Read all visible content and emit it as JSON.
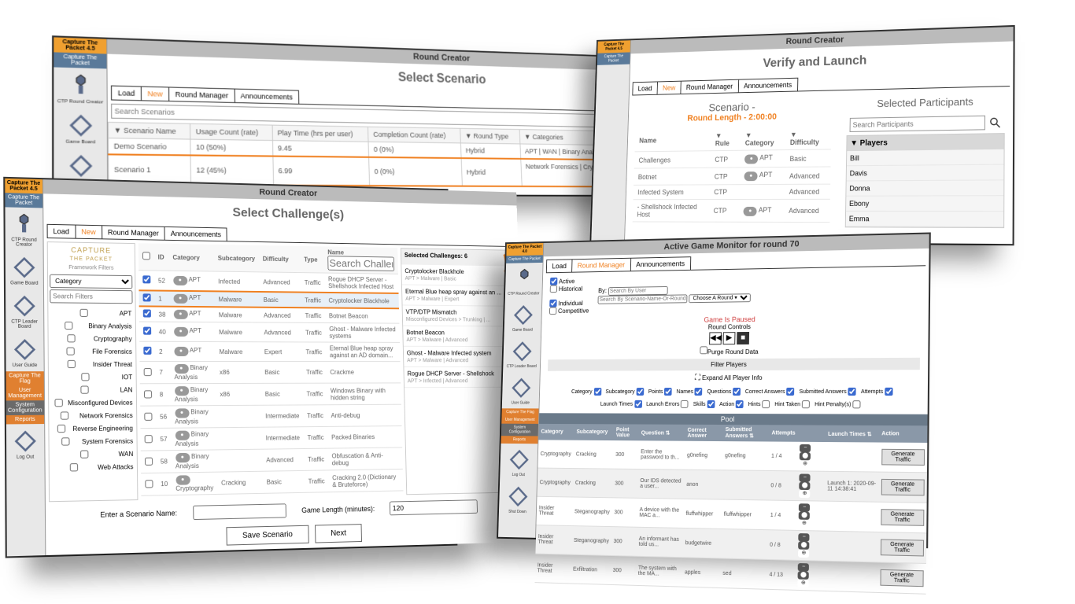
{
  "app": {
    "title45": "Capture The Packet 4.5",
    "title40": "Capture The Packet 4.0",
    "name": "Capture The Packet"
  },
  "sidebar": {
    "items": [
      {
        "label": "CTP Round Creator"
      },
      {
        "label": "Game Board"
      },
      {
        "label": "CTP Leader Board"
      },
      {
        "label": "User Guide"
      }
    ],
    "admin": [
      {
        "label": "Capture The Flag"
      },
      {
        "label": "User Management"
      },
      {
        "label": "System Configuration"
      },
      {
        "label": "Reports"
      }
    ],
    "bottom": [
      {
        "label": "Log Out"
      },
      {
        "label": "Shut Down"
      }
    ]
  },
  "round_creator": "Round Creator",
  "tabs": {
    "load": "Load",
    "new": "New",
    "manager": "Round Manager",
    "ann": "Announcements"
  },
  "p1": {
    "heading": "Select Scenario",
    "search_ph": "Search Scenarios",
    "cols": {
      "name": "▼ Scenario Name",
      "usage": "Usage Count (rate)",
      "play": "Play Time (hrs per user)",
      "comp": "Completion Count (rate)",
      "type": "▼ Round Type",
      "cat": "▼ Categories"
    },
    "rows": [
      {
        "name": "Demo Scenario",
        "usage": "10 (50%)",
        "play": "9.45",
        "comp": "0 (0%)",
        "type": "Hybrid",
        "cat": "APT | WAN | Binary Analysis | Insider Threat | System Forensics | ..."
      },
      {
        "name": "Scenario 1",
        "usage": "12 (45%)",
        "play": "6.99",
        "comp": "0 (0%)",
        "type": "Hybrid",
        "cat": "Network Forensics | Cryptography |"
      }
    ]
  },
  "p2": {
    "heading": "Select Challenge(s)",
    "filters": {
      "logo1": "CAPTURE",
      "logo2": "THE PACKET",
      "sub": "Framework Filters",
      "cat_ph": "Category",
      "search_ph": "Search Filters",
      "list": [
        "APT",
        "Binary Analysis",
        "Cryptography",
        "File Forensics",
        "Insider Threat",
        "IOT",
        "LAN",
        "Misconfigured Devices",
        "Network Forensics",
        "Reverse Engineering",
        "System Forensics",
        "WAN",
        "Web Attacks"
      ]
    },
    "ch_cols": {
      "sel": "",
      "id": "ID",
      "cat": "Category",
      "sub": "Subcategory",
      "diff": "Difficulty",
      "type": "Type",
      "name": "Name"
    },
    "ch_search": "Search Challenge Sets",
    "ch_rows": [
      {
        "id": "52",
        "chk": true,
        "cat": "APT",
        "sub": "Infected",
        "diff": "Advanced",
        "type": "Traffic",
        "name": "Rogue DHCP Server - Shellshock Infected Host"
      },
      {
        "id": "1",
        "chk": true,
        "sel": true,
        "cat": "APT",
        "sub": "Malware",
        "diff": "Basic",
        "type": "Traffic",
        "name": "Cryptolocker Blackhole"
      },
      {
        "id": "38",
        "chk": true,
        "cat": "APT",
        "sub": "Malware",
        "diff": "Advanced",
        "type": "Traffic",
        "name": "Botnet Beacon"
      },
      {
        "id": "40",
        "chk": true,
        "cat": "APT",
        "sub": "Malware",
        "diff": "Advanced",
        "type": "Traffic",
        "name": "Ghost - Malware Infected systems"
      },
      {
        "id": "2",
        "chk": true,
        "cat": "APT",
        "sub": "Malware",
        "diff": "Expert",
        "type": "Traffic",
        "name": "Eternal Blue heap spray against an AD domain..."
      },
      {
        "id": "7",
        "chk": false,
        "cat": "Binary Analysis",
        "sub": "x86",
        "diff": "Basic",
        "type": "Traffic",
        "name": "Crackme"
      },
      {
        "id": "8",
        "chk": false,
        "cat": "Binary Analysis",
        "sub": "x86",
        "diff": "Basic",
        "type": "Traffic",
        "name": "Windows Binary with hidden string"
      },
      {
        "id": "56",
        "chk": false,
        "cat": "Binary Analysis",
        "sub": "",
        "diff": "Intermediate",
        "type": "Traffic",
        "name": "Anti-debug"
      },
      {
        "id": "57",
        "chk": false,
        "cat": "Binary Analysis",
        "sub": "",
        "diff": "Intermediate",
        "type": "Traffic",
        "name": "Packed Binaries"
      },
      {
        "id": "58",
        "chk": false,
        "cat": "Binary Analysis",
        "sub": "",
        "diff": "Advanced",
        "type": "Traffic",
        "name": "Obfuscation & Anti-debug"
      },
      {
        "id": "10",
        "chk": false,
        "cat": "Cryptography",
        "sub": "Cracking",
        "diff": "Basic",
        "type": "Traffic",
        "name": "Cracking 2.0 (Dictionary & Bruteforce)"
      }
    ],
    "sel": {
      "title": "Selected Challenges: 6",
      "items": [
        {
          "n": "Cryptolocker Blackhole",
          "s": "APT > Malware | Basic"
        },
        {
          "n": "Eternal Blue heap spray against an ...",
          "s": "APT > Malware | Expert"
        },
        {
          "n": "VTP/DTP Mismatch",
          "s": "Misconfigured Devices > Trunking | ..."
        },
        {
          "n": "Botnet Beacon",
          "s": "APT > Malware | Advanced"
        },
        {
          "n": "Ghost - Malware Infected system",
          "s": "APT > Malware | Advanced"
        },
        {
          "n": "Rogue DHCP Server - Shellshock",
          "s": "APT > Infected | Advanced"
        }
      ]
    },
    "form": {
      "name_lbl": "Enter a Scenario Name:",
      "len_lbl": "Game Length (minutes):",
      "len_val": "120",
      "save": "Save Scenario",
      "next": "Next"
    }
  },
  "p3": {
    "heading": "Verify and Launch",
    "sc_title": "Scenario -",
    "sc_len": "Round Length - 2:00:00",
    "cols": {
      "name": "Name",
      "rule": "▼ Rule",
      "cat": "▼ Category",
      "diff": "▼ Difficulty"
    },
    "rows": [
      {
        "name": "Challenges",
        "rule": "CTP",
        "cat": "APT",
        "diff": "Basic"
      },
      {
        "name": "Botnet",
        "rule": "CTP",
        "cat": "APT",
        "diff": "Advanced"
      },
      {
        "name": "Infected System",
        "rule": "CTP",
        "cat": "",
        "diff": "Advanced"
      },
      {
        "name": "- Shellshock Infected Host",
        "rule": "CTP",
        "cat": "APT",
        "diff": "Advanced"
      }
    ],
    "part": {
      "title": "Selected Participants",
      "search_ph": "Search Participants",
      "hd": "▼ Players",
      "list": [
        "Bill",
        "Davis",
        "Donna",
        "Ebony",
        "Emma"
      ]
    }
  },
  "p4": {
    "topbar": "Active Game Monitor for round 70",
    "filt": {
      "active": "Active",
      "historical": "Historical",
      "individual": "Individual",
      "competitive": "Competitive",
      "by": "By:",
      "search_user": "Search By User",
      "search_sc": "Search By Scenario-Name-Or-Round",
      "choose": "Choose A Round ▾"
    },
    "status": "Game Is Paused",
    "rc": "Round Controls",
    "purge": "Purge Round Data",
    "filt_players": "Filter Players",
    "expand": "Expand All Player Info",
    "chks": [
      "Category",
      "Subcategory",
      "Points",
      "Names",
      "Questions",
      "Correct Answers",
      "Submitted Answers",
      "Attempts",
      "Launch Times",
      "Launch Errors",
      "Skills",
      "Action",
      "Hints",
      "Hint Taken",
      "Hint Penalty(s)"
    ],
    "pool": "Pool",
    "pcols": {
      "cat": "Category",
      "sub": "Subcategory",
      "pts": "Point Value",
      "q": "Question ⇅",
      "ca": "Correct Answer",
      "sa": "Submitted Answers ⇅",
      "at": "Attempts",
      "lt": "Launch Times ⇅",
      "act": "Action"
    },
    "prows": [
      {
        "cat": "Cryptography",
        "sub": "Cracking",
        "pts": "300",
        "q": "Enter the password to th...",
        "ca": "g0nefing",
        "sa": "g0nefing",
        "at": "1 / 4",
        "lt": "",
        "act": "Generate Traffic"
      },
      {
        "cat": "Cryptography",
        "sub": "Cracking",
        "pts": "300",
        "q": "Our IDS detected a user...",
        "ca": "anon",
        "sa": "",
        "at": "0 / 8",
        "lt": "Launch 1: 2020-09-11 14:38:41",
        "act": "Generate Traffic"
      },
      {
        "cat": "Insider Threat",
        "sub": "Steganography",
        "pts": "300",
        "q": "A device with the MAC a...",
        "ca": "fluffwhipper",
        "sa": "fluffwhipper",
        "at": "1 / 4",
        "lt": "",
        "act": "Generate Traffic"
      },
      {
        "cat": "Insider Threat",
        "sub": "Steganography",
        "pts": "300",
        "q": "An informant has told us...",
        "ca": "budgetwire",
        "sa": "",
        "at": "0 / 8",
        "lt": "",
        "act": "Generate Traffic"
      },
      {
        "cat": "Insider Threat",
        "sub": "Exfiltration",
        "pts": "300",
        "q": "The system with the MA...",
        "ca": "apples",
        "sa": "sed",
        "at": "4 / 13",
        "lt": "",
        "act": "Generate Traffic"
      }
    ]
  }
}
